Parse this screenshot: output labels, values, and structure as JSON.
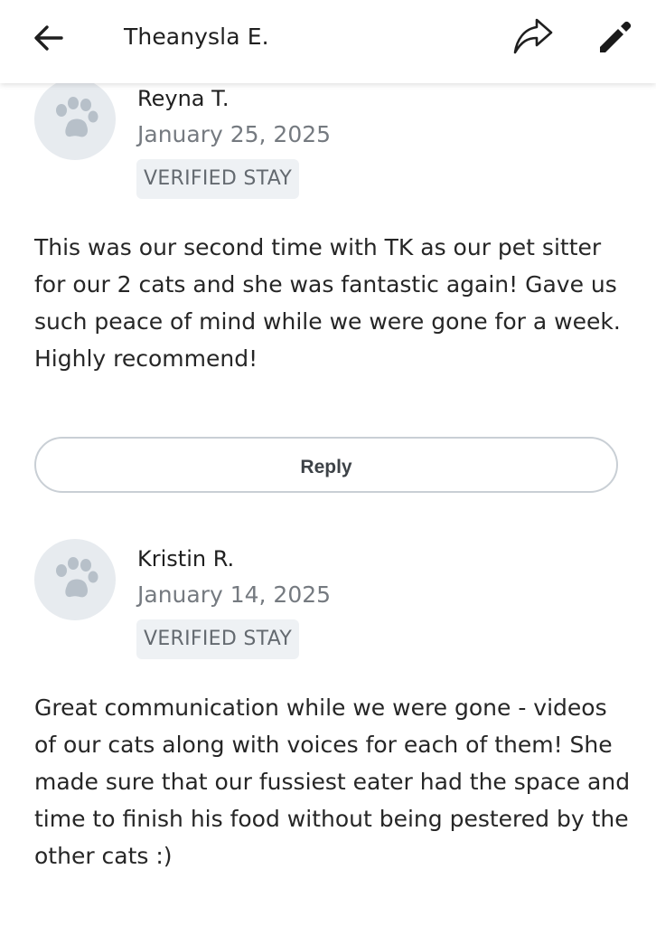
{
  "header": {
    "title": "Theanysla E."
  },
  "reviews": [
    {
      "name": "Reyna T.",
      "date": "January 25, 2025",
      "badge": "VERIFIED STAY",
      "text": "This was our second time with TK as our pet sitter for our 2 cats and she was fantastic again! Gave us such peace of mind while we were gone for a week. Highly recommend!"
    },
    {
      "name": "Kristin R.",
      "date": "January 14, 2025",
      "badge": "VERIFIED STAY",
      "text": "Great communication while we were gone - videos of our cats along with voices for each of them!  She made sure that our fussiest eater had the space and time to finish his food without being pestered by the other cats :)"
    }
  ],
  "reply_button": {
    "label": "Reply"
  },
  "colors": {
    "avatar_bg": "#e7ebef",
    "paw": "#b7c0c9",
    "badge_bg": "#eef1f4",
    "muted_text": "#757a80"
  }
}
